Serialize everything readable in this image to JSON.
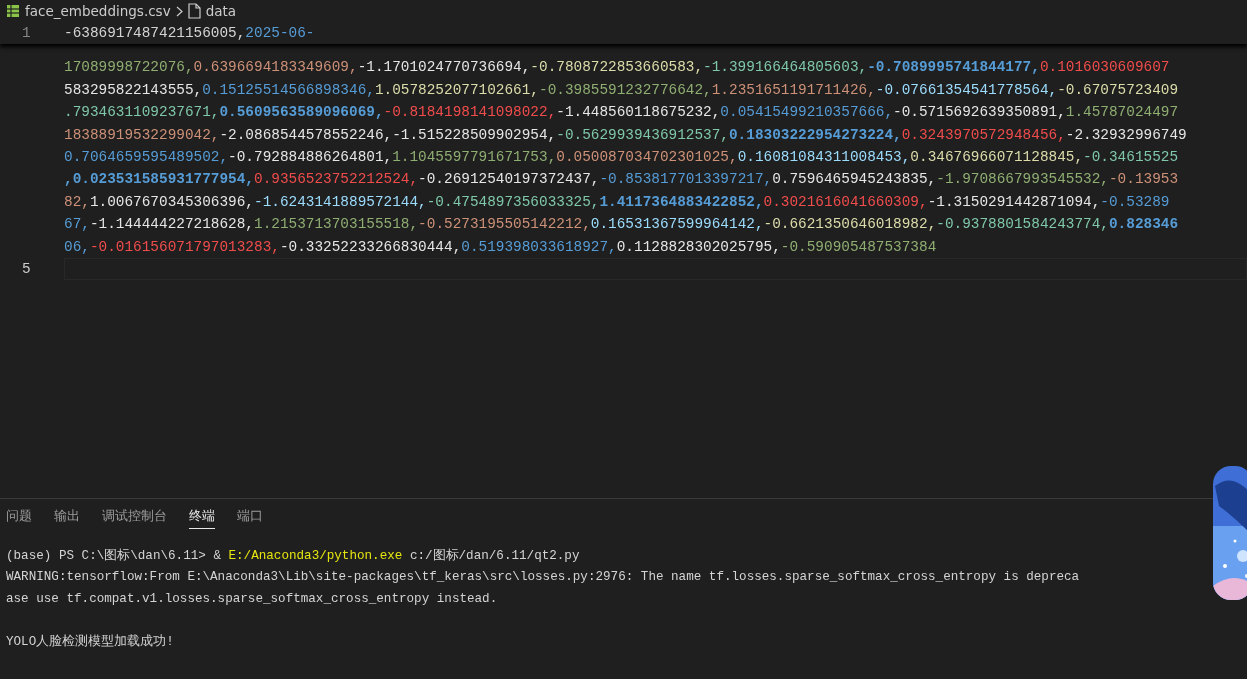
{
  "breadcrumb": {
    "file": "face_embeddings.csv",
    "symbol": "data"
  },
  "editor": {
    "sticky_line": {
      "number": "1",
      "segments": [
        {
          "text": "-6386917487421156005,",
          "color": "#d4d4d4",
          "bold": false
        },
        {
          "text": "2025-06-",
          "color": "#569cd6",
          "bold": false
        }
      ]
    },
    "rows": [
      {
        "segments": [
          {
            "text": "17089998722076,",
            "color": "#8fae72",
            "bold": false
          },
          {
            "text": "0.6396694183349609,",
            "color": "#ce9178",
            "bold": false
          },
          {
            "text": "-1.1701024770736694,",
            "color": "#e6e6e6",
            "bold": false
          },
          {
            "text": "-0.7808722853660583,",
            "color": "#dcdcaa",
            "bold": false
          },
          {
            "text": "-1.399166464805603,",
            "color": "#7fc8a9",
            "bold": false
          },
          {
            "text": "-0.7089995741844177,",
            "color": "#569cd6",
            "bold": true
          },
          {
            "text": "0.1016030609607",
            "color": "#f14c4c",
            "bold": false
          }
        ]
      },
      {
        "segments": [
          {
            "text": "583295822143555,",
            "color": "#e6e6e6",
            "bold": false
          },
          {
            "text": "0.15125514566898346,",
            "color": "#569cd6",
            "bold": false
          },
          {
            "text": "1.0578252077102661,",
            "color": "#dcdcaa",
            "bold": false
          },
          {
            "text": "-0.3985591232776642,",
            "color": "#8fae72",
            "bold": false
          },
          {
            "text": "1.2351651191711426,",
            "color": "#ce9178",
            "bold": false
          },
          {
            "text": "-0.07661354541778564,",
            "color": "#9cdcfe",
            "bold": false
          },
          {
            "text": "-0.67075723409",
            "color": "#dcdcaa",
            "bold": false
          }
        ]
      },
      {
        "segments": [
          {
            "text": ".7934631109237671,",
            "color": "#7fc8a9",
            "bold": false
          },
          {
            "text": "0.5609563589096069,",
            "color": "#569cd6",
            "bold": true
          },
          {
            "text": "-0.8184198141098022,",
            "color": "#f14c4c",
            "bold": false
          },
          {
            "text": "-1.448560118675232,",
            "color": "#e6e6e6",
            "bold": false
          },
          {
            "text": "0.05415499210357666,",
            "color": "#569cd6",
            "bold": false
          },
          {
            "text": "-0.5715692639350891,",
            "color": "#e6e6e6",
            "bold": false
          },
          {
            "text": "1.45787024497",
            "color": "#8fae72",
            "bold": false
          }
        ]
      },
      {
        "segments": [
          {
            "text": "18388919532299042,",
            "color": "#ce9178",
            "bold": false
          },
          {
            "text": "-2.0868544578552246,",
            "color": "#e6e6e6",
            "bold": false
          },
          {
            "text": "-1.515228509902954,",
            "color": "#e6e6e6",
            "bold": false
          },
          {
            "text": "-0.5629939436912537,",
            "color": "#7fc8a9",
            "bold": false
          },
          {
            "text": "0.18303222954273224,",
            "color": "#569cd6",
            "bold": true
          },
          {
            "text": "0.3243970572948456,",
            "color": "#f14c4c",
            "bold": false
          },
          {
            "text": "-2.32932996749",
            "color": "#e6e6e6",
            "bold": false
          }
        ]
      },
      {
        "segments": [
          {
            "text": "0.7064659595489502,",
            "color": "#569cd6",
            "bold": false
          },
          {
            "text": "-0.792884886264801,",
            "color": "#e6e6e6",
            "bold": false
          },
          {
            "text": "1.1045597791671753,",
            "color": "#8fae72",
            "bold": false
          },
          {
            "text": "0.050087034702301025,",
            "color": "#ce9178",
            "bold": false
          },
          {
            "text": "0.16081084311008453,",
            "color": "#9cdcfe",
            "bold": false
          },
          {
            "text": "0.34676966071128845,",
            "color": "#dcdcaa",
            "bold": false
          },
          {
            "text": "-0.34615525",
            "color": "#7fc8a9",
            "bold": false
          }
        ]
      },
      {
        "segments": [
          {
            "text": ",0.023531585931777954,",
            "color": "#569cd6",
            "bold": true
          },
          {
            "text": "0.9356523752212524,",
            "color": "#f14c4c",
            "bold": false
          },
          {
            "text": "-0.26912540197372437,",
            "color": "#e6e6e6",
            "bold": false
          },
          {
            "text": "-0.8538177013397217,",
            "color": "#569cd6",
            "bold": false
          },
          {
            "text": "0.7596465945243835,",
            "color": "#e6e6e6",
            "bold": false
          },
          {
            "text": "-1.9708667993545532,",
            "color": "#8fae72",
            "bold": false
          },
          {
            "text": "-0.13953",
            "color": "#ce9178",
            "bold": false
          }
        ]
      },
      {
        "segments": [
          {
            "text": "82,",
            "color": "#ce9178",
            "bold": false
          },
          {
            "text": "1.0067670345306396,",
            "color": "#e6e6e6",
            "bold": false
          },
          {
            "text": "-1.6243141889572144,",
            "color": "#9cdcfe",
            "bold": false
          },
          {
            "text": "-0.4754897356033325,",
            "color": "#7fc8a9",
            "bold": false
          },
          {
            "text": "1.4117364883422852,",
            "color": "#569cd6",
            "bold": true
          },
          {
            "text": "0.3021616041660309,",
            "color": "#f14c4c",
            "bold": false
          },
          {
            "text": "-1.3150291442871094,",
            "color": "#e6e6e6",
            "bold": false
          },
          {
            "text": "-0.53289",
            "color": "#569cd6",
            "bold": false
          }
        ]
      },
      {
        "segments": [
          {
            "text": "67,",
            "color": "#569cd6",
            "bold": false
          },
          {
            "text": "-1.144444227218628,",
            "color": "#e6e6e6",
            "bold": false
          },
          {
            "text": "1.2153713703155518,",
            "color": "#8fae72",
            "bold": false
          },
          {
            "text": "-0.5273195505142212,",
            "color": "#ce9178",
            "bold": false
          },
          {
            "text": "0.16531367599964142,",
            "color": "#9cdcfe",
            "bold": false
          },
          {
            "text": "-0.6621350646018982,",
            "color": "#dcdcaa",
            "bold": false
          },
          {
            "text": "-0.9378801584243774,",
            "color": "#7fc8a9",
            "bold": false
          },
          {
            "text": "0.828346",
            "color": "#569cd6",
            "bold": true
          }
        ]
      },
      {
        "segments": [
          {
            "text": "06,",
            "color": "#569cd6",
            "bold": false
          },
          {
            "text": "-0.016156071797013283,",
            "color": "#f14c4c",
            "bold": false
          },
          {
            "text": "-0.33252233266830444,",
            "color": "#e6e6e6",
            "bold": false
          },
          {
            "text": "0.519398033618927,",
            "color": "#569cd6",
            "bold": false
          },
          {
            "text": "0.1128828302025795,",
            "color": "#e6e6e6",
            "bold": false
          },
          {
            "text": "-0.590905487537384",
            "color": "#8fae72",
            "bold": false
          }
        ]
      }
    ],
    "current_line": {
      "number": "5"
    }
  },
  "panel": {
    "tabs": [
      {
        "label": "问题",
        "selected": false
      },
      {
        "label": "输出",
        "selected": false
      },
      {
        "label": "调试控制台",
        "selected": false
      },
      {
        "label": "终端",
        "selected": true
      },
      {
        "label": "端口",
        "selected": false
      }
    ],
    "terminal_lines": [
      {
        "kind": "command",
        "segments": [
          {
            "text": "(base) PS C:\\图标\\dan\\6.11> & ",
            "color": "#d4d4d4"
          },
          {
            "text": "E:/Anaconda3/python.exe",
            "color": "#e5e510"
          },
          {
            "text": " c:/图标/dan/6.11/qt2.py",
            "color": "#d4d4d4"
          }
        ]
      },
      {
        "kind": "output",
        "segments": [
          {
            "text": "WARNING:tensorflow:From E:\\Anaconda3\\Lib\\site-packages\\tf_keras\\src\\losses.py:2976: The name tf.losses.sparse_softmax_cross_entropy is depreca",
            "color": "#d4d4d4"
          }
        ]
      },
      {
        "kind": "output",
        "segments": [
          {
            "text": "ase use tf.compat.v1.losses.sparse_softmax_cross_entropy instead.",
            "color": "#d4d4d4"
          }
        ]
      },
      {
        "kind": "message",
        "segments": [
          {
            "text": "YOLO人脸检测模型加载成功!",
            "color": "#d4d4d4"
          }
        ]
      }
    ]
  }
}
